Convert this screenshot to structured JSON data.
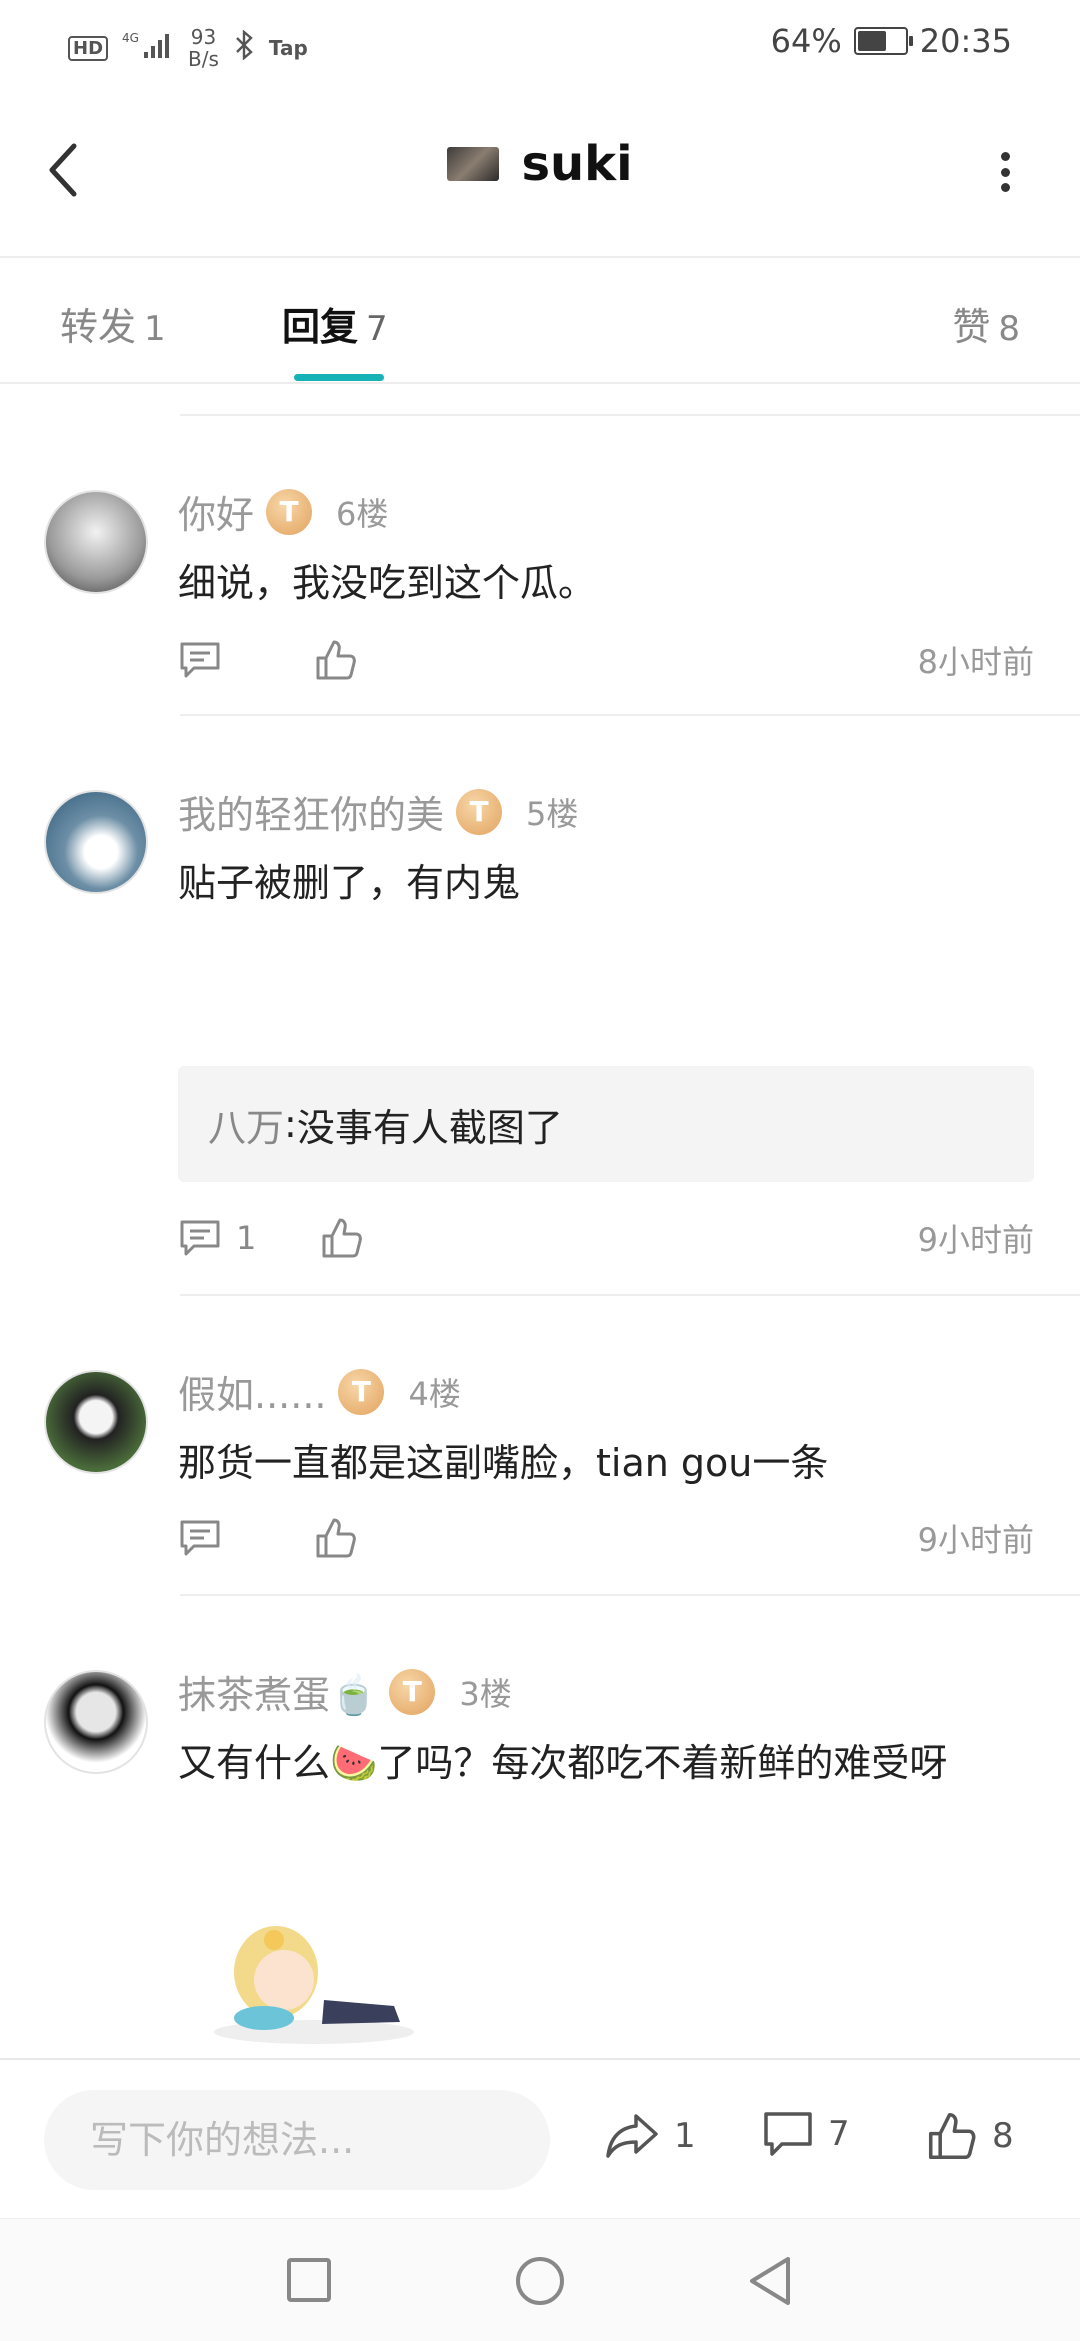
{
  "status_bar": {
    "left": {
      "hd": "HD",
      "signal": "4G",
      "speed_value": "93",
      "speed_unit": "B/s",
      "bluetooth_icon": "bluetooth-icon",
      "app": "Tap"
    },
    "battery": "64%",
    "battery_level": 0.64,
    "time": "20:35"
  },
  "header": {
    "title": "suki",
    "back_icon": "back-arrow-icon",
    "more_icon": "more-vertical-icon"
  },
  "tabs": [
    {
      "label": "转发",
      "count": "1"
    },
    {
      "label": "回复",
      "count": "7"
    },
    {
      "label": "赞",
      "count": "8"
    }
  ],
  "comments": [
    {
      "name": "你好",
      "level": "T",
      "floor": "6楼",
      "text": "细说，我没吃到这个瓜。",
      "time": "8小时前",
      "comment_count": "",
      "avatar_icon": "avatar-icon"
    },
    {
      "name": "我的轻狂你的美",
      "level": "T",
      "floor": "5楼",
      "text": "贴子被删了，有内鬼",
      "reply": {
        "name": "八万",
        "sep": " : ",
        "text": "没事有人截图了"
      },
      "time": "9小时前",
      "comment_count": "1",
      "avatar_icon": "avatar-icon"
    },
    {
      "name": "假如......",
      "level": "T",
      "floor": "4楼",
      "text": "那货一直都是这副嘴脸，tian gou一条",
      "time": "9小时前",
      "comment_count": "",
      "avatar_icon": "avatar-icon"
    },
    {
      "name": "抹茶煮蛋🍵",
      "level": "T",
      "floor": "3楼",
      "text": "又有什么🍉了吗？每次都吃不着新鲜的难受呀",
      "avatar_icon": "avatar-icon"
    }
  ],
  "bottom_bar": {
    "placeholder": "写下你的想法...",
    "share_count": "1",
    "comment_count": "7",
    "like_count": "8"
  },
  "nav_bar": {
    "square_icon": "recent-apps-icon",
    "circle_icon": "home-icon",
    "triangle_icon": "back-icon"
  }
}
